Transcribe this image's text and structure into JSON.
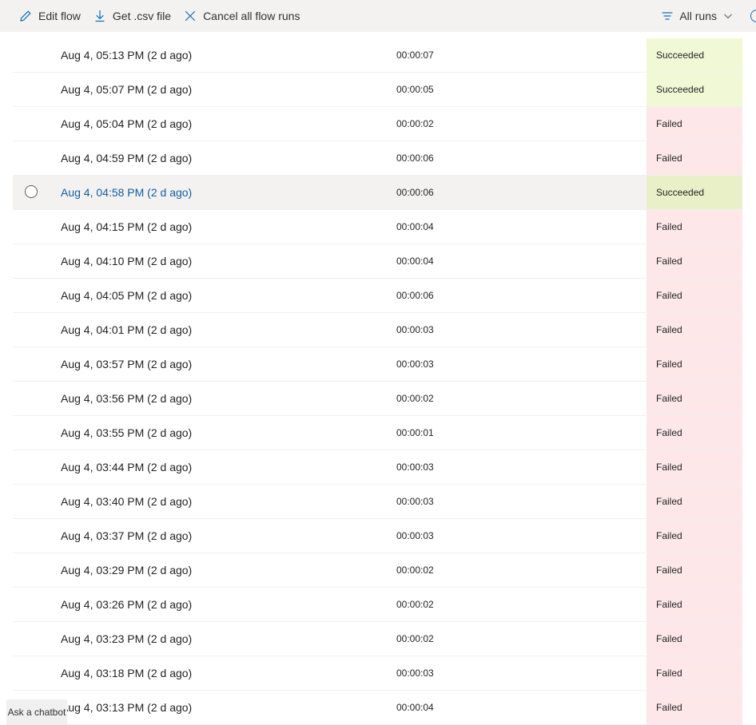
{
  "toolbar": {
    "edit_flow": "Edit flow",
    "get_csv": "Get .csv file",
    "cancel_all": "Cancel all flow runs",
    "filter_label": "All runs",
    "accent": "#0f6cbd"
  },
  "runs": [
    {
      "start": "Aug 4, 05:13 PM (2 d ago)",
      "duration": "00:00:07",
      "status": "Succeeded"
    },
    {
      "start": "Aug 4, 05:07 PM (2 d ago)",
      "duration": "00:00:05",
      "status": "Succeeded"
    },
    {
      "start": "Aug 4, 05:04 PM (2 d ago)",
      "duration": "00:00:02",
      "status": "Failed"
    },
    {
      "start": "Aug 4, 04:59 PM (2 d ago)",
      "duration": "00:00:06",
      "status": "Failed"
    },
    {
      "start": "Aug 4, 04:58 PM (2 d ago)",
      "duration": "00:00:06",
      "status": "Succeeded"
    },
    {
      "start": "Aug 4, 04:15 PM (2 d ago)",
      "duration": "00:00:04",
      "status": "Failed"
    },
    {
      "start": "Aug 4, 04:10 PM (2 d ago)",
      "duration": "00:00:04",
      "status": "Failed"
    },
    {
      "start": "Aug 4, 04:05 PM (2 d ago)",
      "duration": "00:00:06",
      "status": "Failed"
    },
    {
      "start": "Aug 4, 04:01 PM (2 d ago)",
      "duration": "00:00:03",
      "status": "Failed"
    },
    {
      "start": "Aug 4, 03:57 PM (2 d ago)",
      "duration": "00:00:03",
      "status": "Failed"
    },
    {
      "start": "Aug 4, 03:56 PM (2 d ago)",
      "duration": "00:00:02",
      "status": "Failed"
    },
    {
      "start": "Aug 4, 03:55 PM (2 d ago)",
      "duration": "00:00:01",
      "status": "Failed"
    },
    {
      "start": "Aug 4, 03:44 PM (2 d ago)",
      "duration": "00:00:03",
      "status": "Failed"
    },
    {
      "start": "Aug 4, 03:40 PM (2 d ago)",
      "duration": "00:00:03",
      "status": "Failed"
    },
    {
      "start": "Aug 4, 03:37 PM (2 d ago)",
      "duration": "00:00:03",
      "status": "Failed"
    },
    {
      "start": "Aug 4, 03:29 PM (2 d ago)",
      "duration": "00:00:02",
      "status": "Failed"
    },
    {
      "start": "Aug 4, 03:26 PM (2 d ago)",
      "duration": "00:00:02",
      "status": "Failed"
    },
    {
      "start": "Aug 4, 03:23 PM (2 d ago)",
      "duration": "00:00:02",
      "status": "Failed"
    },
    {
      "start": "Aug 4, 03:18 PM (2 d ago)",
      "duration": "00:00:03",
      "status": "Failed"
    },
    {
      "start": "Aug 4, 03:13 PM (2 d ago)",
      "duration": "00:00:04",
      "status": "Failed"
    }
  ],
  "chatbot": {
    "label": "Ask a chatbot"
  }
}
